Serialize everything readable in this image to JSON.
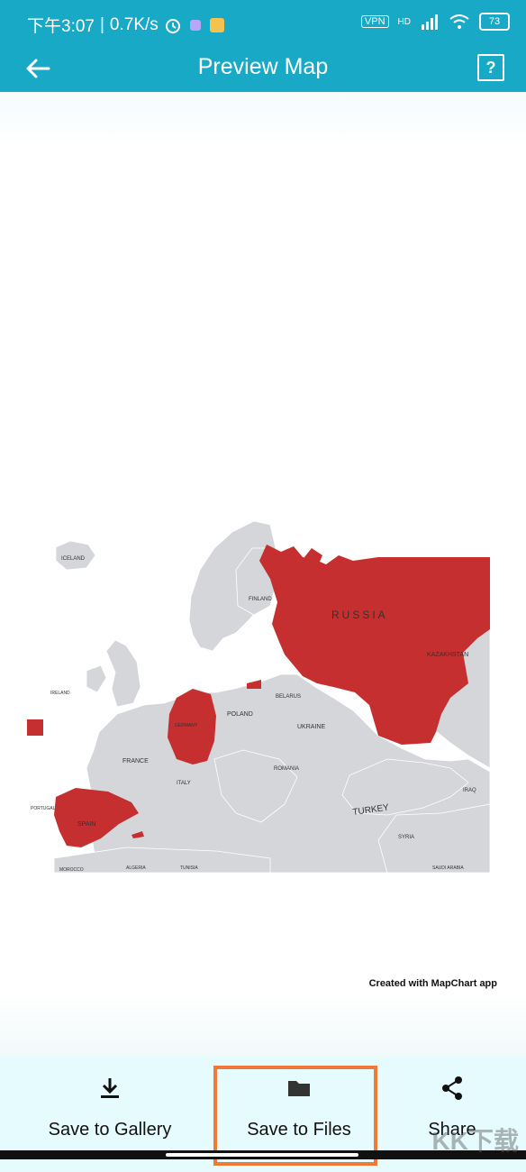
{
  "status": {
    "time": "下午3:07",
    "speed": "0.7K/s",
    "battery": "73",
    "vpn": "VPN",
    "network": "HD"
  },
  "toolbar": {
    "title": "Preview Map",
    "help": "?"
  },
  "map": {
    "fill_highlight": "#c62f2f",
    "fill_base": "#d4d6da",
    "labels": {
      "iceland": "ICELAND",
      "finland": "FINLAND",
      "russia": "RUSSIA",
      "kazakhstan": "KAZAKHSTAN",
      "belarus": "BELARUS",
      "poland": "POLAND",
      "germany": "GERMANY",
      "ukraine": "UKRAINE",
      "france": "FRANCE",
      "ireland": "IRELAND",
      "romania": "ROMANIA",
      "italy": "ITALY",
      "portugal": "PORTUGAL",
      "spain": "SPAIN",
      "turkey": "TURKEY",
      "syria": "SYRIA",
      "iraq": "IRAQ",
      "morocco": "MOROCCO",
      "algeria": "ALGERIA",
      "tunisia": "TUNISIA",
      "saudi": "SAUDI ARABIA"
    }
  },
  "credit": "Created with MapChart app",
  "actions": {
    "gallery": "Save to Gallery",
    "files": "Save to Files",
    "share": "Share"
  },
  "watermark": "KK下载"
}
